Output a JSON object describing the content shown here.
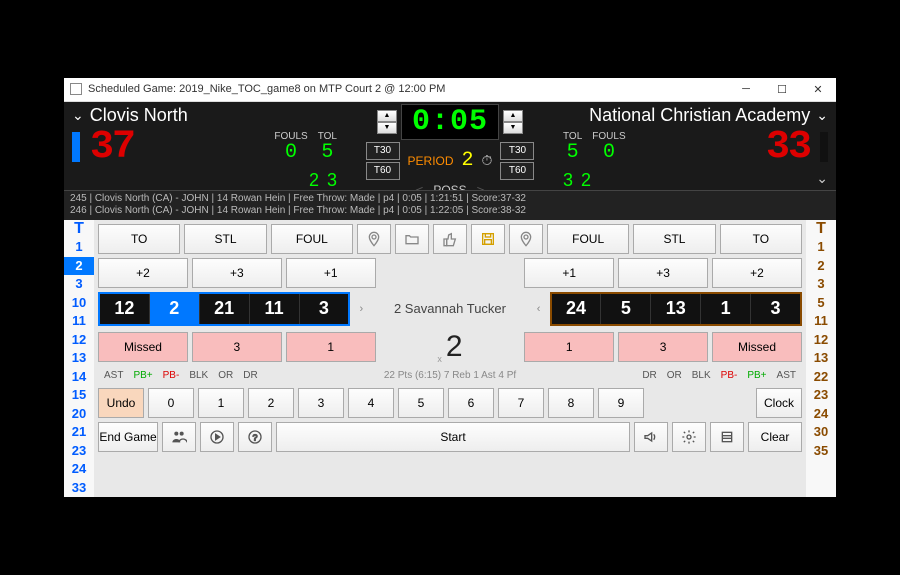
{
  "window_title": "Scheduled Game: 2019_Nike_TOC_game8 on MTP Court 2 @ 12:00 PM",
  "home": {
    "name": "Clovis North",
    "score": "37",
    "fouls": "0",
    "tol": "5",
    "bonus": [
      "2",
      "3"
    ],
    "color": "#0078ff",
    "roster": [
      "1",
      "2",
      "3",
      "10",
      "11",
      "12",
      "13",
      "14",
      "15",
      "20",
      "21",
      "23",
      "24",
      "33"
    ],
    "selected_index": 1,
    "lineup": [
      "12",
      "2",
      "21",
      "11",
      "3"
    ],
    "lineup_sel_index": 1,
    "action_top": {
      "to": "TO",
      "stl": "STL",
      "foul": "FOUL"
    },
    "points": {
      "p2": "+2",
      "p3": "+3",
      "p1": "+1"
    },
    "missed_row": {
      "missed": "Missed",
      "three": "3",
      "one": "1"
    },
    "substats": [
      "AST",
      "PB+",
      "PB-",
      "BLK",
      "OR",
      "DR"
    ]
  },
  "away": {
    "name": "National Christian Academy",
    "score": "33",
    "fouls": "0",
    "tol": "5",
    "bonus": [
      "3",
      "2"
    ],
    "color": "#8a4b00",
    "roster": [
      "1",
      "2",
      "3",
      "5",
      "11",
      "12",
      "13",
      "22",
      "23",
      "24",
      "30",
      "35"
    ],
    "lineup": [
      "24",
      "5",
      "13",
      "1",
      "3"
    ],
    "action_top": {
      "foul": "FOUL",
      "stl": "STL",
      "to": "TO"
    },
    "points": {
      "p1": "+1",
      "p3": "+3",
      "p2": "+2"
    },
    "missed_row": {
      "one": "1",
      "three": "3",
      "missed": "Missed"
    },
    "substats": [
      "DR",
      "OR",
      "BLK",
      "PB-",
      "PB+",
      "AST"
    ]
  },
  "clock": "0:05",
  "period_label": "PERIOD",
  "period_num": "2",
  "poss_label": "POSS",
  "timeout_btns": {
    "t30": "T30",
    "t60": "T60"
  },
  "log": [
    "245 | Clovis North (CA) - JOHN | 14 Rowan Hein | Free Throw: Made | p4 | 0:05 | 1:21:51 | Score:37-32",
    "246 | Clovis North (CA) - JOHN | 14 Rowan Hein | Free Throw: Made | p4 | 0:05 | 1:22:05 | Score:38-32"
  ],
  "selected_player": {
    "label": "2 Savannah Tucker",
    "number": "2",
    "stats": "22 Pts (6:15) 7 Reb 1 Ast 4 Pf"
  },
  "numpad": [
    "0",
    "1",
    "2",
    "3",
    "4",
    "5",
    "6",
    "7",
    "8",
    "9"
  ],
  "controls": {
    "undo": "Undo",
    "clock": "Clock",
    "end_game": "End Game",
    "start": "Start",
    "clear": "Clear"
  },
  "fouls_label": "FOULS",
  "tol_label": "TOL",
  "roster_header": "T"
}
